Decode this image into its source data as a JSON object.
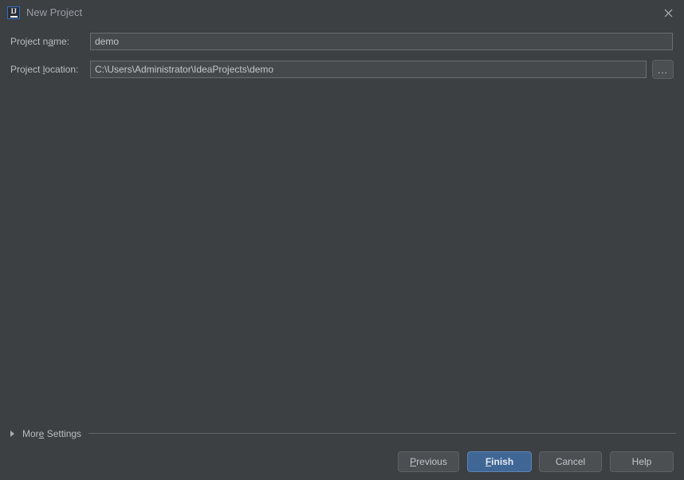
{
  "window": {
    "title": "New Project",
    "app_icon": "intellij-idea-icon",
    "icon_letters": "IJ",
    "close_icon": "close-icon",
    "background_color": "#3c4043"
  },
  "form": {
    "project_name": {
      "label_before": "Project n",
      "label_mnemonic": "a",
      "label_after": "me:",
      "label_full": "Project name:",
      "value": "demo",
      "placeholder": ""
    },
    "project_location": {
      "label_before": "Project ",
      "label_mnemonic": "l",
      "label_after": "ocation:",
      "label_full": "Project location:",
      "value": "C:\\Users\\Administrator\\IdeaProjects\\demo",
      "placeholder": ""
    },
    "browse_button": {
      "label": "...",
      "icon": "ellipsis-icon"
    }
  },
  "more_settings": {
    "label_before": "Mor",
    "label_mnemonic": "e",
    "label_after": " Settings",
    "label_full": "More Settings",
    "expanded": false,
    "arrow_icon": "chevron-right-icon"
  },
  "buttons": {
    "previous": {
      "label_mnemonic": "P",
      "label_after": "revious",
      "label_full": "Previous",
      "default": false
    },
    "finish": {
      "label_mnemonic": "F",
      "label_after": "inish",
      "label_full": "Finish",
      "default": true,
      "accent_color": "#3f6695"
    },
    "cancel": {
      "label_full": "Cancel",
      "default": false
    },
    "help": {
      "label_full": "Help",
      "default": false
    }
  }
}
